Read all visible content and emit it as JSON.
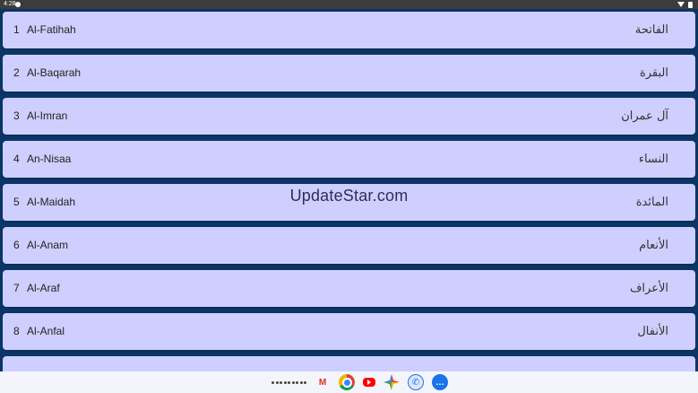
{
  "status_bar": {
    "time": "4:28"
  },
  "surahs": [
    {
      "number": "1",
      "name": "Al-Fatihah",
      "arabic": "الفاتحة"
    },
    {
      "number": "2",
      "name": "Al-Baqarah",
      "arabic": "البقرة"
    },
    {
      "number": "3",
      "name": "Al-Imran",
      "arabic": "آل عمران"
    },
    {
      "number": "4",
      "name": "An-Nisaa",
      "arabic": "النساء"
    },
    {
      "number": "5",
      "name": "Al-Maidah",
      "arabic": "المائدة"
    },
    {
      "number": "6",
      "name": "Al-Anam",
      "arabic": "الأنعام"
    },
    {
      "number": "7",
      "name": "Al-Araf",
      "arabic": "الأعراف"
    },
    {
      "number": "8",
      "name": "Al-Anfal",
      "arabic": "الأنفال"
    },
    {
      "number": "",
      "name": "",
      "arabic": ""
    }
  ],
  "watermark": "UpdateStar.com",
  "taskbar": {
    "apps": [
      {
        "name": "apps-grid",
        "icon": "apps-grid-icon"
      },
      {
        "name": "Gmail",
        "icon": "gmail-icon",
        "glyph": "M"
      },
      {
        "name": "Chrome",
        "icon": "chrome-icon"
      },
      {
        "name": "YouTube",
        "icon": "youtube-icon"
      },
      {
        "name": "Photos",
        "icon": "photos-icon"
      },
      {
        "name": "Phone",
        "icon": "phone-icon",
        "glyph": "✆"
      },
      {
        "name": "Messages",
        "icon": "messages-icon",
        "glyph": "…"
      }
    ]
  },
  "colors": {
    "background": "#0b3566",
    "row": "#cfcfff",
    "taskbar": "#f4f5fb"
  }
}
